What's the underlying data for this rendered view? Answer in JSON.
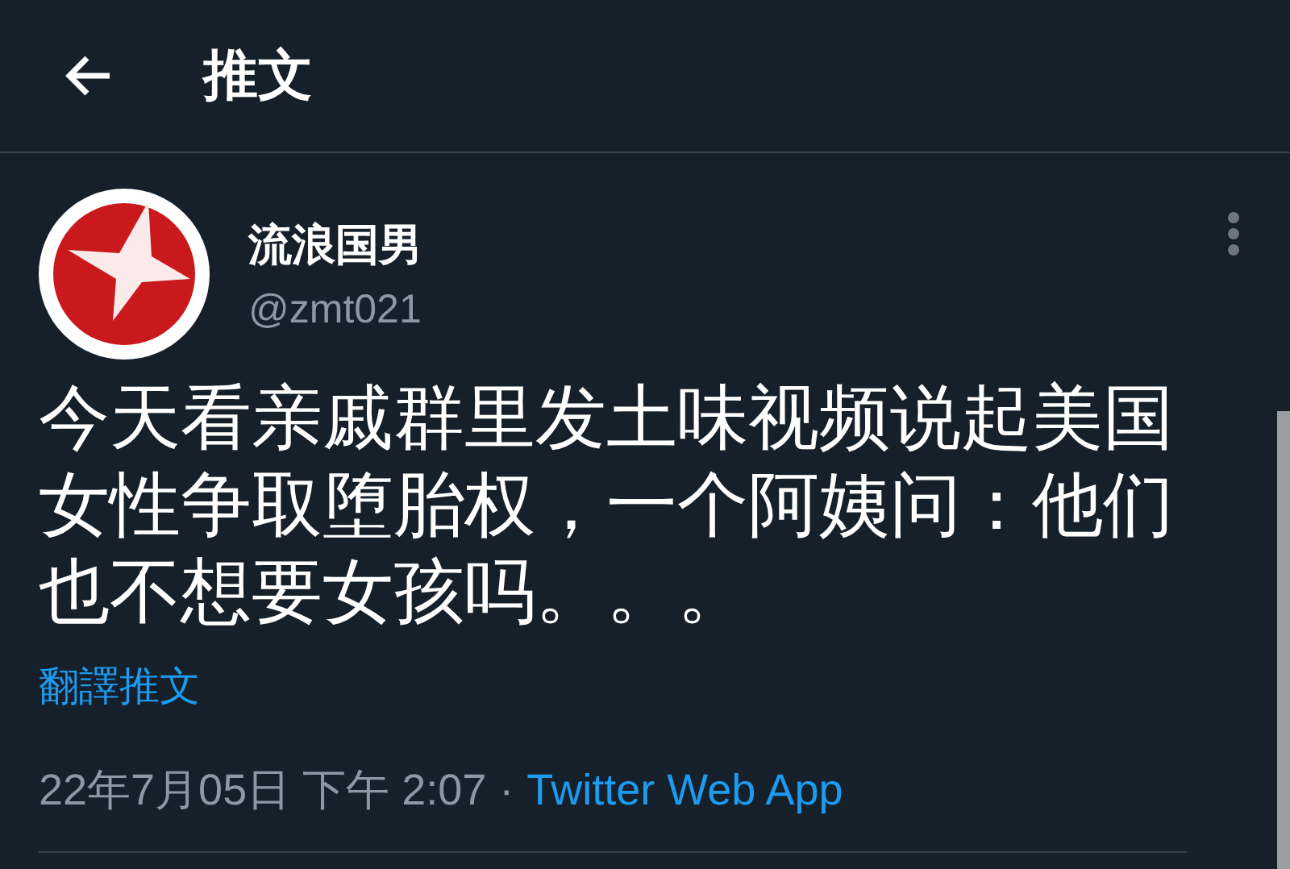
{
  "header": {
    "title": "推文"
  },
  "tweet": {
    "name": "流浪国男",
    "handle": "@zmt021",
    "text": "今天看亲戚群里发土味视频说起美国女性争取堕胎权，一个阿姨问：他们也不想要女孩吗。。。",
    "translate": "翻譯推文",
    "timestamp": "22年7月05日 下午 2:07",
    "separator": "·",
    "source": "Twitter Web App"
  }
}
